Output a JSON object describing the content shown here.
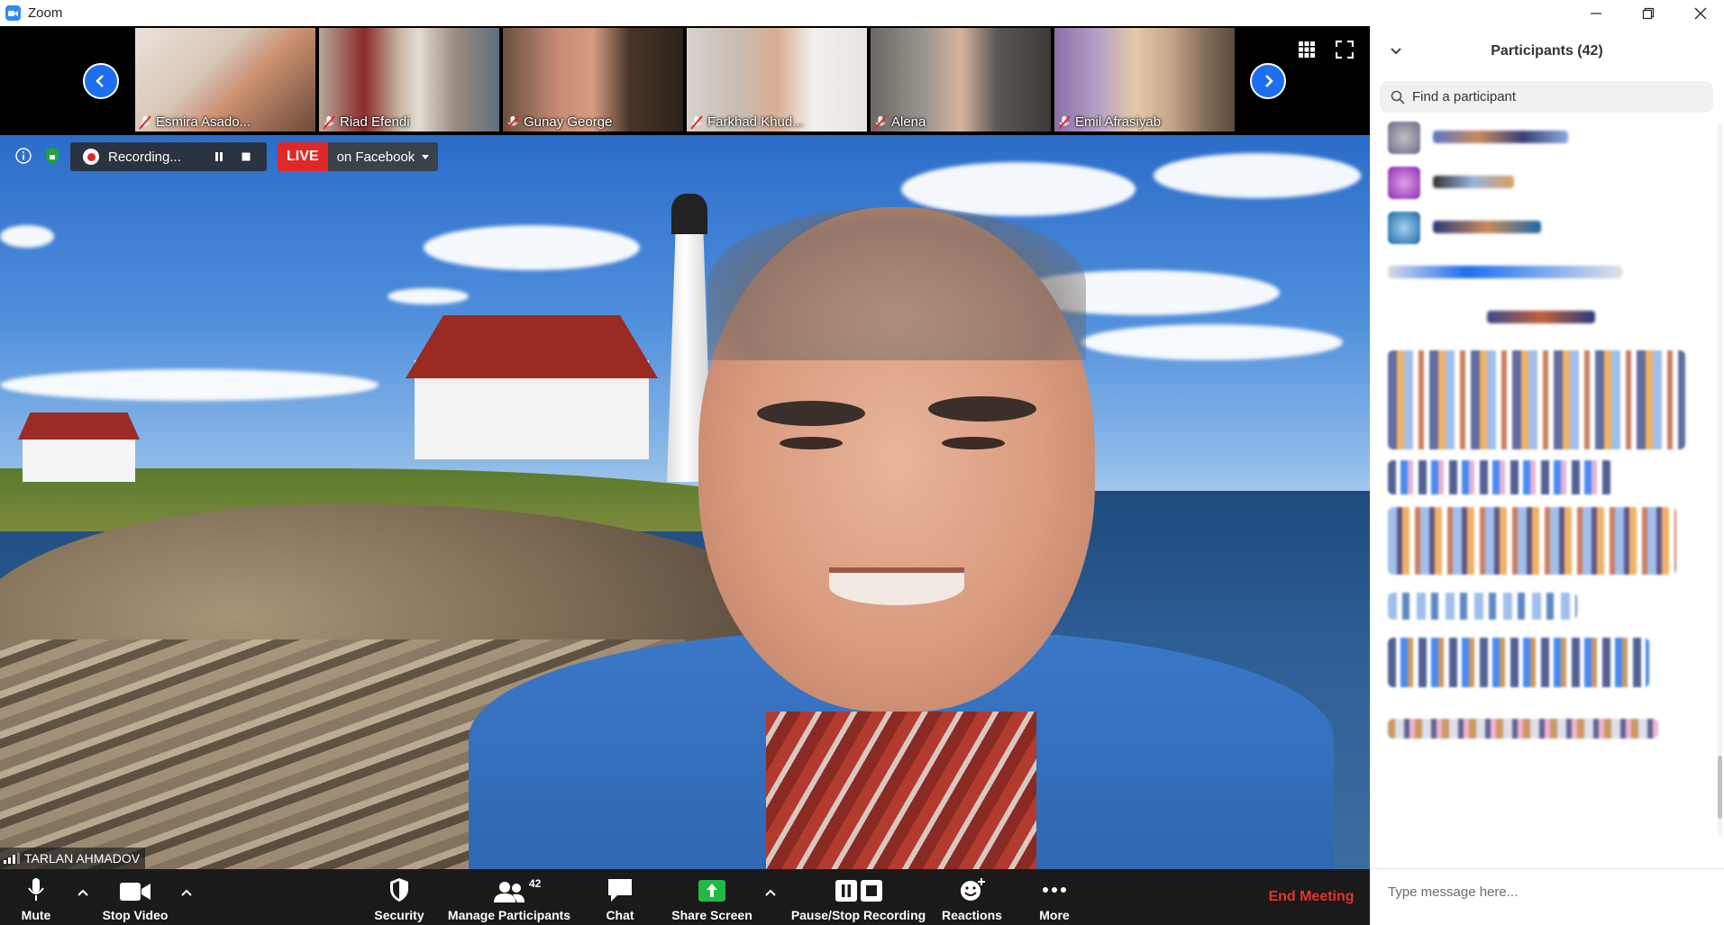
{
  "window": {
    "title": "Zoom"
  },
  "gallery": {
    "participants": [
      {
        "name": "Esmira Asado...",
        "muted": true
      },
      {
        "name": "Riad Efendi",
        "muted": true
      },
      {
        "name": "Gunay George",
        "muted": true
      },
      {
        "name": "Farkhad Khud...",
        "muted": true
      },
      {
        "name": "Alena",
        "muted": true
      },
      {
        "name": "Emil Afrasiyab",
        "muted": true
      }
    ]
  },
  "recording": {
    "status": "Recording...",
    "live_label": "LIVE",
    "live_target": "on Facebook"
  },
  "speaker": {
    "name": "TARLAN AHMADOV"
  },
  "toolbar": {
    "mute": "Mute",
    "stop_video": "Stop Video",
    "security": "Security",
    "manage_participants": "Manage Participants",
    "participant_count": "42",
    "chat": "Chat",
    "share_screen": "Share Screen",
    "pause_stop_recording": "Pause/Stop Recording",
    "reactions": "Reactions",
    "more": "More",
    "end_meeting": "End Meeting"
  },
  "panel": {
    "title": "Participants (42)",
    "search_placeholder": "Find a participant",
    "message_placeholder": "Type message here..."
  },
  "colors": {
    "accent": "#2D8CFF",
    "live_red": "#e02828",
    "end_meeting_red": "#e8322b",
    "share_green": "#1fb944",
    "toolbar_bg": "#1a1a1a"
  }
}
